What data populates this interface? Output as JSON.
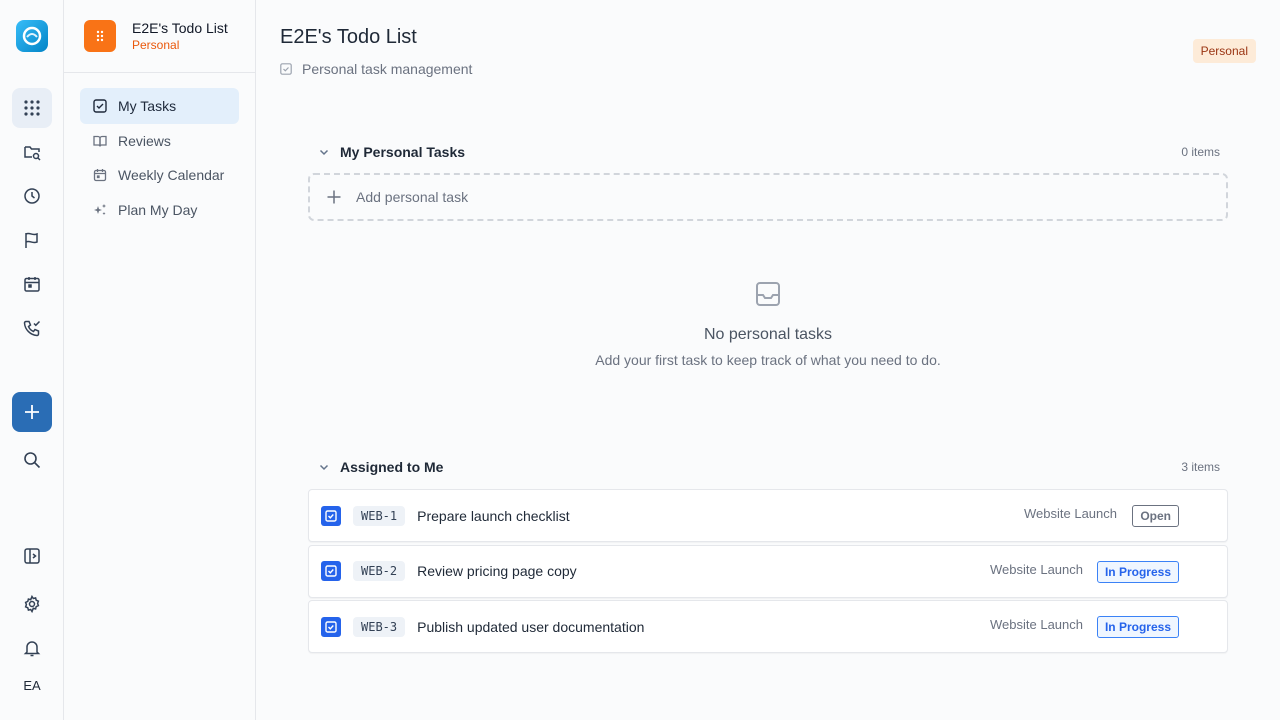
{
  "rail": {
    "user_initials": "EA"
  },
  "workspace": {
    "name": "E2E's Todo List",
    "type": "Personal"
  },
  "sidebar": {
    "items": [
      {
        "label": "My Tasks",
        "icon": "checkbox-square-icon",
        "active": true
      },
      {
        "label": "Reviews",
        "icon": "book-open-icon",
        "active": false
      },
      {
        "label": "Weekly Calendar",
        "icon": "calendar-icon",
        "active": false
      },
      {
        "label": "Plan My Day",
        "icon": "sparkles-icon",
        "active": false
      }
    ]
  },
  "header": {
    "title": "E2E's Todo List",
    "subtitle": "Personal task management",
    "badge": "Personal"
  },
  "personal_section": {
    "title": "My Personal Tasks",
    "count": "0 items",
    "add_label": "Add personal task",
    "empty_title": "No personal tasks",
    "empty_desc": "Add your first task to keep track of what you need to do."
  },
  "assigned_section": {
    "title": "Assigned to Me",
    "count": "3 items",
    "tasks": [
      {
        "id": "WEB-1",
        "title": "Prepare launch checklist",
        "project": "Website Launch",
        "status": "Open"
      },
      {
        "id": "WEB-2",
        "title": "Review pricing page copy",
        "project": "Website Launch",
        "status": "In Progress"
      },
      {
        "id": "WEB-3",
        "title": "Publish updated user documentation",
        "project": "Website Launch",
        "status": "In Progress"
      }
    ]
  },
  "colors": {
    "accent": "#2563eb",
    "workspace_orange": "#f97316",
    "in_progress": "#2563eb",
    "open": "#6b7280"
  }
}
